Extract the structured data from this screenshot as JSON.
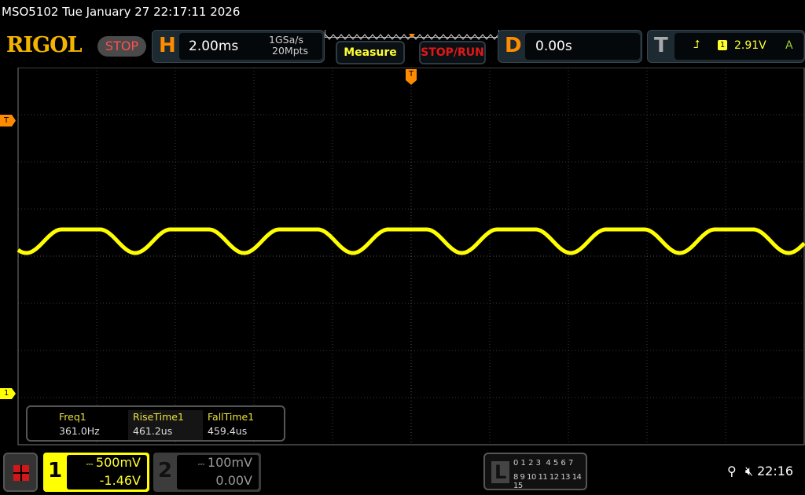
{
  "header": {
    "title": "MSO5102  Tue January 27 22:17:11 2026",
    "logo": "RIGOL",
    "run_state": "STOP"
  },
  "horizontal": {
    "letter": "H",
    "timebase": "2.00ms",
    "sample_rate": "1GSa/s",
    "memory_depth": "20Mpts"
  },
  "buttons": {
    "measure": "Measure",
    "stop_run": "STOP/RUN"
  },
  "delay": {
    "letter": "D",
    "value": "0.00s"
  },
  "trigger": {
    "letter": "T",
    "source": "1",
    "level": "2.91V",
    "mode": "A",
    "marker": "T"
  },
  "measurements": [
    {
      "label": "Freq1",
      "value": "361.0Hz"
    },
    {
      "label": "RiseTime1",
      "value": "461.2us"
    },
    {
      "label": "FallTime1",
      "value": "459.4us"
    }
  ],
  "channels": [
    {
      "num": "1",
      "scale": "500mV",
      "offset": "-1.46V",
      "color": "#ffff00"
    },
    {
      "num": "2",
      "scale": "100mV",
      "offset": "0.00V",
      "color": "#3c3c3c"
    }
  ],
  "logic": {
    "letter": "L",
    "row1": "0 1 2 3  4 5 6 7",
    "row2": "8 9 10 11 12 13 14 15"
  },
  "status": {
    "mute_icon": "speaker-muted",
    "usb_icon": "usb",
    "time": "22:16"
  },
  "chart_data": {
    "type": "line",
    "series": [
      {
        "name": "1",
        "color": "#ffff00"
      }
    ],
    "frequency_hz": 361.0,
    "time_per_div_ms": 2.0,
    "volts_per_div": 0.5,
    "grid": true
  }
}
